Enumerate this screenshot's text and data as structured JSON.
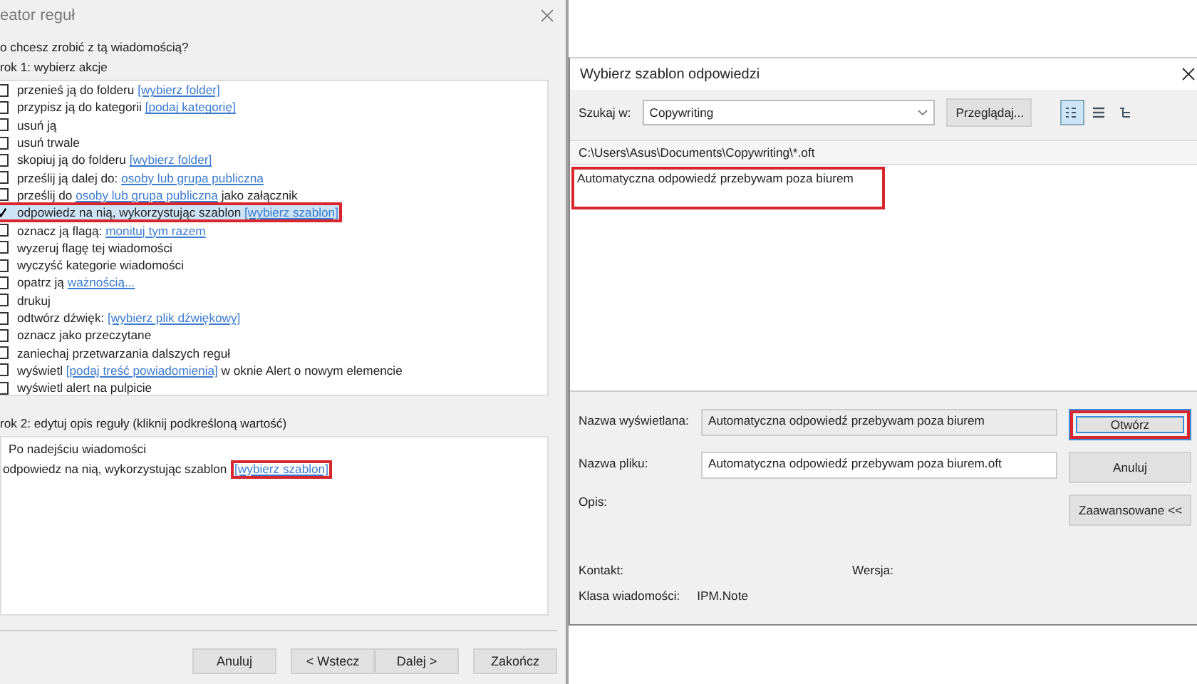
{
  "rules_wizard": {
    "title": "eator reguł",
    "question": "o chcesz zrobić z tą wiadomością?",
    "step1_label": "rok 1: wybierz akcje",
    "actions": [
      {
        "parts": [
          {
            "text": "przenieś ją do folderu ",
            "link": false
          },
          {
            "text": "[wybierz folder]",
            "link": true
          }
        ],
        "checked": false,
        "selected": false,
        "highlighted": false
      },
      {
        "parts": [
          {
            "text": "przypisz ją do kategorii ",
            "link": false
          },
          {
            "text": "[podaj kategorię]",
            "link": true
          }
        ],
        "checked": false,
        "selected": false,
        "highlighted": false
      },
      {
        "parts": [
          {
            "text": "usuń ją",
            "link": false
          }
        ],
        "checked": false,
        "selected": false,
        "highlighted": false
      },
      {
        "parts": [
          {
            "text": "usuń trwale",
            "link": false
          }
        ],
        "checked": false,
        "selected": false,
        "highlighted": false
      },
      {
        "parts": [
          {
            "text": "skopiuj ją do folderu ",
            "link": false
          },
          {
            "text": "[wybierz folder]",
            "link": true
          }
        ],
        "checked": false,
        "selected": false,
        "highlighted": false
      },
      {
        "parts": [
          {
            "text": "prześlij ją dalej do: ",
            "link": false
          },
          {
            "text": "osoby lub grupa publiczna",
            "link": true
          }
        ],
        "checked": false,
        "selected": false,
        "highlighted": false
      },
      {
        "parts": [
          {
            "text": "prześlij do ",
            "link": false
          },
          {
            "text": "osoby lub grupa publiczna",
            "link": true
          },
          {
            "text": " jako załącznik",
            "link": false
          }
        ],
        "checked": false,
        "selected": false,
        "highlighted": false
      },
      {
        "parts": [
          {
            "text": "odpowiedz na nią, wykorzystując szablon ",
            "link": false
          },
          {
            "text": "[wybierz szablon]",
            "link": true
          }
        ],
        "checked": true,
        "selected": true,
        "highlighted": true
      },
      {
        "parts": [
          {
            "text": "oznacz ją flagą: ",
            "link": false
          },
          {
            "text": "monituj tym razem",
            "link": true
          }
        ],
        "checked": false,
        "selected": false,
        "highlighted": false
      },
      {
        "parts": [
          {
            "text": "wyzeruj flagę tej wiadomości",
            "link": false
          }
        ],
        "checked": false,
        "selected": false,
        "highlighted": false
      },
      {
        "parts": [
          {
            "text": "wyczyść kategorie wiadomości",
            "link": false
          }
        ],
        "checked": false,
        "selected": false,
        "highlighted": false
      },
      {
        "parts": [
          {
            "text": "opatrz ją ",
            "link": false
          },
          {
            "text": "ważnością...",
            "link": true
          }
        ],
        "checked": false,
        "selected": false,
        "highlighted": false
      },
      {
        "parts": [
          {
            "text": "drukuj",
            "link": false
          }
        ],
        "checked": false,
        "selected": false,
        "highlighted": false
      },
      {
        "parts": [
          {
            "text": "odtwórz dźwięk: ",
            "link": false
          },
          {
            "text": "[wybierz plik dźwiękowy]",
            "link": true
          }
        ],
        "checked": false,
        "selected": false,
        "highlighted": false
      },
      {
        "parts": [
          {
            "text": "oznacz jako przeczytane",
            "link": false
          }
        ],
        "checked": false,
        "selected": false,
        "highlighted": false
      },
      {
        "parts": [
          {
            "text": "zaniechaj przetwarzania dalszych reguł",
            "link": false
          }
        ],
        "checked": false,
        "selected": false,
        "highlighted": false
      },
      {
        "parts": [
          {
            "text": "wyświetl ",
            "link": false
          },
          {
            "text": "[podaj treść powiadomienia]",
            "link": true
          },
          {
            "text": " w oknie Alert o nowym elemencie",
            "link": false
          }
        ],
        "checked": false,
        "selected": false,
        "highlighted": false
      },
      {
        "parts": [
          {
            "text": "wyświetl alert na pulpicie",
            "link": false
          }
        ],
        "checked": false,
        "selected": false,
        "highlighted": false
      }
    ],
    "step2_label": "rok 2: edytuj opis reguły (kliknij podkreśloną wartość)",
    "description": [
      {
        "parts": [
          {
            "text": "Po nadejściu wiadomości",
            "link": false,
            "highlighted": false
          }
        ]
      },
      {
        "parts": [
          {
            "text": "odpowiedz na nią, wykorzystując szablon ",
            "link": false,
            "highlighted": false
          },
          {
            "text": "[wybierz szablon]",
            "link": true,
            "highlighted": true
          }
        ]
      }
    ],
    "buttons": [
      {
        "label": "Anuluj"
      },
      {
        "label": "< Wstecz"
      },
      {
        "label": "Dalej >"
      },
      {
        "label": "Zakończ"
      }
    ]
  },
  "template_dialog": {
    "title": "Wybierz szablon odpowiedzi",
    "look_in_label": "Szukaj w:",
    "look_in_value": "Copywriting",
    "browse_button": "Przeglądaj...",
    "view_buttons": [
      {
        "kind": "list",
        "selected": true
      },
      {
        "kind": "details",
        "selected": false
      },
      {
        "kind": "properties",
        "selected": false
      }
    ],
    "path": "C:\\Users\\Asus\\Documents\\Copywriting\\*.oft",
    "files": [
      {
        "name": "Automatyczna odpowiedź przebywam poza biurem",
        "highlighted": true
      }
    ],
    "fields": [
      {
        "label": "Nazwa wyświetlana:",
        "value": "Automatyczna odpowiedź przebywam poza biurem",
        "disabled": true
      },
      {
        "label": "Nazwa pliku:",
        "value": "Automatyczna odpowiedź przebywam poza biurem.oft",
        "disabled": false
      }
    ],
    "description_label": "Opis:",
    "buttons": [
      {
        "label": "Otwórz",
        "default": true,
        "highlighted": true
      },
      {
        "label": "Anuluj",
        "default": false,
        "highlighted": false
      },
      {
        "label": "Zaawansowane <<",
        "default": false,
        "highlighted": false
      }
    ],
    "contact_label": "Kontakt:",
    "version_label": "Wersja:",
    "class_label": "Klasa wiadomości:",
    "class_value": "IPM.Note"
  }
}
